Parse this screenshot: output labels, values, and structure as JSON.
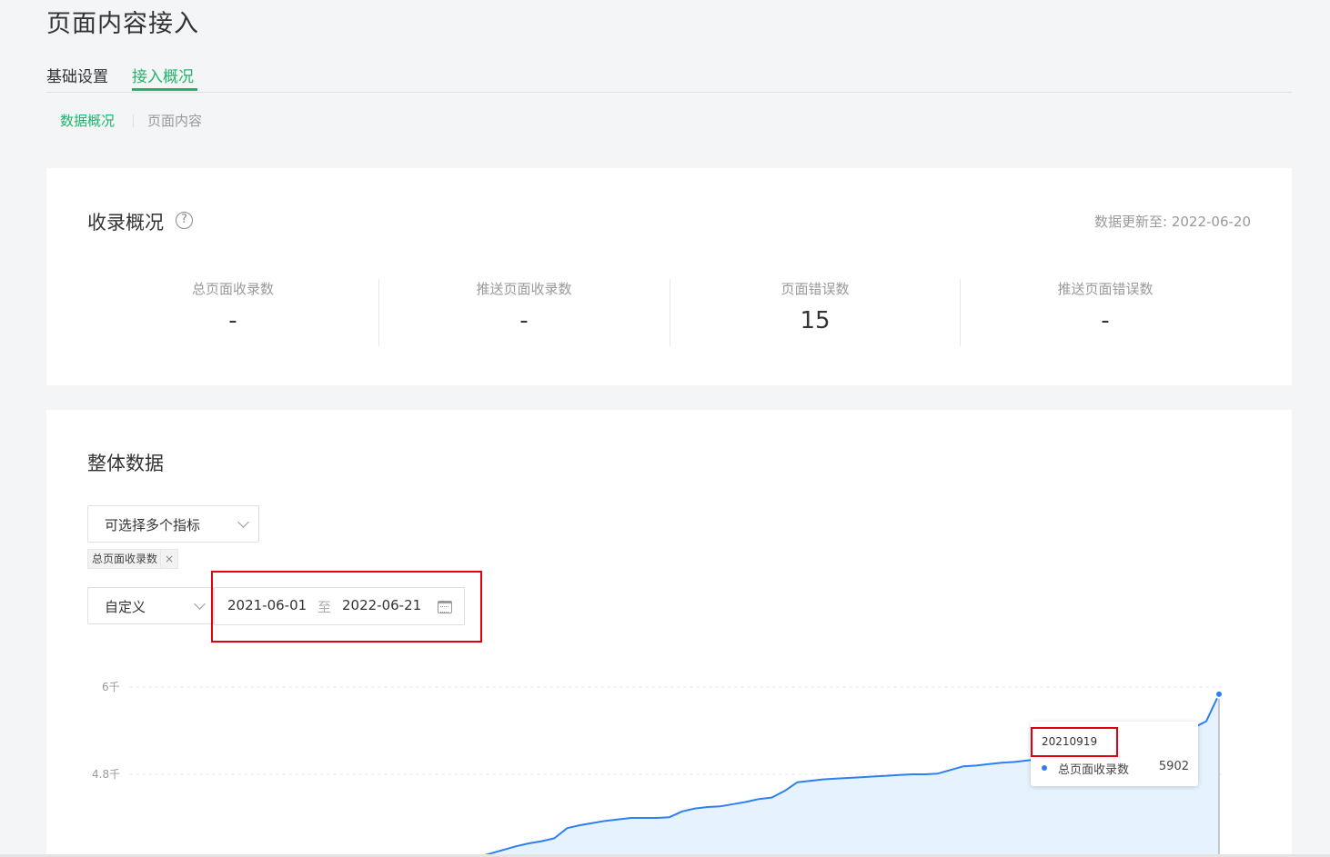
{
  "page": {
    "title": "页面内容接入"
  },
  "tabs": [
    {
      "label": "基础设置",
      "active": false
    },
    {
      "label": "接入概况",
      "active": true
    }
  ],
  "subtabs": [
    {
      "label": "数据概况",
      "active": true
    },
    {
      "label": "页面内容",
      "active": false
    }
  ],
  "overview": {
    "title": "收录概况",
    "help_icon": "question-circle-icon",
    "update_time": "数据更新至: 2022-06-20",
    "stats": [
      {
        "label": "总页面收录数",
        "value": "-"
      },
      {
        "label": "推送页面收录数",
        "value": "-"
      },
      {
        "label": "页面错误数",
        "value": "15"
      },
      {
        "label": "推送页面错误数",
        "value": "-"
      }
    ]
  },
  "overall": {
    "title": "整体数据",
    "metric_select": {
      "placeholder": "可选择多个指标",
      "icon": "chevron-down-icon"
    },
    "selected_tags": [
      {
        "label": "总页面收录数",
        "close": "×"
      }
    ],
    "period_select": {
      "value": "自定义",
      "icon": "chevron-down-icon"
    },
    "date_range": {
      "start": "2021-06-01",
      "separator": "至",
      "end": "2022-06-21",
      "icon": "calendar-icon"
    }
  },
  "chart_data": {
    "type": "area",
    "title": "",
    "xlabel": "",
    "ylabel": "",
    "y_ticks": [
      "6千",
      "4.8千"
    ],
    "ylim": [
      3600,
      6000
    ],
    "grid": true,
    "series": [
      {
        "name": "总页面收录数",
        "color": "#2e7ff0",
        "fill": "#e6f2fd",
        "values": [
          3600,
          3620,
          3660,
          3710,
          3760,
          3810,
          3850,
          3880,
          3920,
          4060,
          4100,
          4130,
          4160,
          4180,
          4200,
          4200,
          4200,
          4210,
          4290,
          4330,
          4350,
          4360,
          4390,
          4420,
          4460,
          4480,
          4570,
          4690,
          4710,
          4730,
          4740,
          4750,
          4760,
          4770,
          4780,
          4790,
          4800,
          4800,
          4810,
          4860,
          4910,
          4920,
          4940,
          4960,
          4970,
          4990,
          5010,
          5020,
          5030,
          5040,
          5050,
          5060,
          5120,
          5160,
          5200,
          5260,
          5300,
          5350,
          5440,
          5530,
          5902
        ]
      }
    ],
    "tooltip": {
      "date": "20210919",
      "series": "总页面收录数",
      "value": "5902"
    }
  }
}
